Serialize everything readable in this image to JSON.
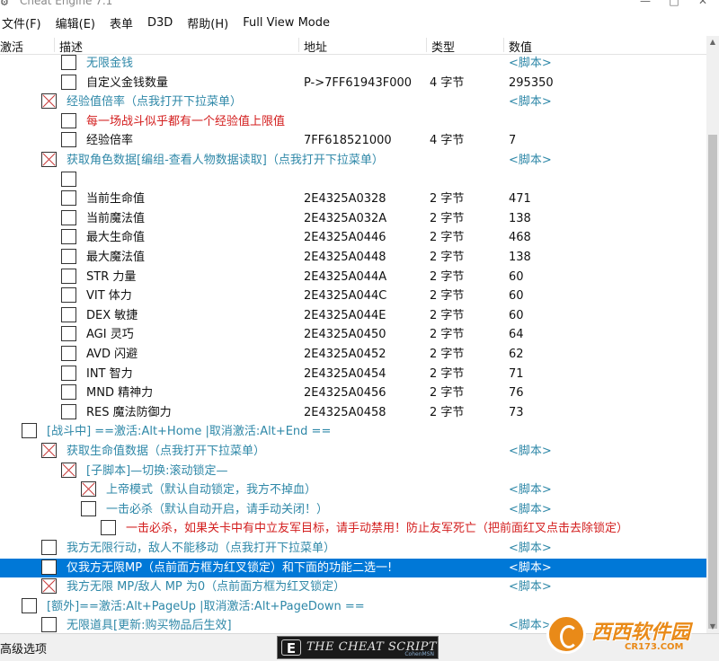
{
  "window": {
    "title": "Cheat Engine 7.1",
    "controls": [
      "—",
      "□",
      "✕"
    ]
  },
  "menu": [
    "文件(F)",
    "编辑(E)",
    "表单",
    "D3D",
    "帮助(H)",
    "Full View Mode"
  ],
  "columns": {
    "active": "激活",
    "description": "描述",
    "address": "地址",
    "type": "类型",
    "value": "数值"
  },
  "rows": [
    {
      "indent": 4,
      "checked": false,
      "desc": "无限金钱",
      "color": "blue",
      "addr": "",
      "type": "",
      "value": "<脚本>",
      "script": true
    },
    {
      "indent": 4,
      "checked": false,
      "desc": "自定义金钱数量",
      "color": "black",
      "addr": "P->7FF61943F000",
      "type": "4 字节",
      "value": "295350"
    },
    {
      "indent": 3,
      "checked": true,
      "desc": "经验值倍率（点我打开下拉菜单）",
      "color": "blue",
      "addr": "",
      "type": "",
      "value": "<脚本>",
      "script": true
    },
    {
      "indent": 4,
      "checked": false,
      "desc": "每一场战斗似乎都有一个经验值上限值",
      "color": "red",
      "addr": "",
      "type": "",
      "value": ""
    },
    {
      "indent": 4,
      "checked": false,
      "desc": "经验倍率",
      "color": "black",
      "addr": "7FF618521000",
      "type": "4 字节",
      "value": "7"
    },
    {
      "indent": 3,
      "checked": true,
      "desc": "获取角色数据[编组-查看人物数据读取]（点我打开下拉菜单）",
      "color": "blue",
      "addr": "",
      "type": "",
      "value": "<脚本>",
      "script": true
    },
    {
      "indent": 4,
      "checked": false,
      "desc": "",
      "color": "black",
      "addr": "",
      "type": "",
      "value": ""
    },
    {
      "indent": 4,
      "checked": false,
      "desc": "当前生命值",
      "color": "black",
      "addr": "2E4325A0328",
      "type": "2 字节",
      "value": "471"
    },
    {
      "indent": 4,
      "checked": false,
      "desc": "当前魔法值",
      "color": "black",
      "addr": "2E4325A032A",
      "type": "2 字节",
      "value": "138"
    },
    {
      "indent": 4,
      "checked": false,
      "desc": "最大生命值",
      "color": "black",
      "addr": "2E4325A0446",
      "type": "2 字节",
      "value": "468"
    },
    {
      "indent": 4,
      "checked": false,
      "desc": "最大魔法值",
      "color": "black",
      "addr": "2E4325A0448",
      "type": "2 字节",
      "value": "138"
    },
    {
      "indent": 4,
      "checked": false,
      "desc": "STR 力量",
      "color": "black",
      "addr": "2E4325A044A",
      "type": "2 字节",
      "value": "60"
    },
    {
      "indent": 4,
      "checked": false,
      "desc": "VIT  体力",
      "color": "black",
      "addr": "2E4325A044C",
      "type": "2 字节",
      "value": "60"
    },
    {
      "indent": 4,
      "checked": false,
      "desc": "DEX 敏捷",
      "color": "black",
      "addr": "2E4325A044E",
      "type": "2 字节",
      "value": "60"
    },
    {
      "indent": 4,
      "checked": false,
      "desc": "AGI 灵巧",
      "color": "black",
      "addr": "2E4325A0450",
      "type": "2 字节",
      "value": "64"
    },
    {
      "indent": 4,
      "checked": false,
      "desc": "AVD 闪避",
      "color": "black",
      "addr": "2E4325A0452",
      "type": "2 字节",
      "value": "62"
    },
    {
      "indent": 4,
      "checked": false,
      "desc": "INT 智力",
      "color": "black",
      "addr": "2E4325A0454",
      "type": "2 字节",
      "value": "71"
    },
    {
      "indent": 4,
      "checked": false,
      "desc": "MND 精神力",
      "color": "black",
      "addr": "2E4325A0456",
      "type": "2 字节",
      "value": "76"
    },
    {
      "indent": 4,
      "checked": false,
      "desc": "RES 魔法防御力",
      "color": "black",
      "addr": "2E4325A0458",
      "type": "2 字节",
      "value": "73"
    },
    {
      "indent": 1,
      "checked": false,
      "desc": "[战斗中] ==激活:Alt+Home |取消激活:Alt+End ==",
      "color": "blue",
      "addr": "",
      "type": "",
      "value": ""
    },
    {
      "indent": 3,
      "checked": true,
      "desc": "获取生命值数据（点我打开下拉菜单）",
      "color": "blue",
      "addr": "",
      "type": "",
      "value": "<脚本>",
      "script": true
    },
    {
      "indent": 4,
      "checked": true,
      "desc": "[子脚本]—切换:滚动锁定—",
      "color": "blue",
      "addr": "",
      "type": "",
      "value": ""
    },
    {
      "indent": 5,
      "checked": true,
      "desc": "上帝模式（默认自动锁定，我方不掉血）",
      "color": "blue",
      "addr": "",
      "type": "",
      "value": "<脚本>",
      "script": true
    },
    {
      "indent": 5,
      "checked": false,
      "desc": "一击必杀（默认自动开启，请手动关闭！）",
      "color": "blue",
      "addr": "",
      "type": "",
      "value": "<脚本>",
      "script": true
    },
    {
      "indent": 6,
      "checked": false,
      "desc": "一击必杀，如果关卡中有中立友军目标，请手动禁用！防止友军死亡（把前面红叉点击去除锁定）",
      "color": "red",
      "addr": "",
      "type": "",
      "value": ""
    },
    {
      "indent": 3,
      "checked": false,
      "desc": "我方无限行动，敌人不能移动（点我打开下拉菜单）",
      "color": "blue",
      "addr": "",
      "type": "",
      "value": "<脚本>",
      "script": true
    },
    {
      "indent": 3,
      "checked": false,
      "desc": "仅我方无限MP（点前面方框为红叉锁定）和下面的功能二选一!",
      "color": "blue",
      "addr": "",
      "type": "",
      "value": "<脚本>",
      "script": true,
      "selected": true
    },
    {
      "indent": 3,
      "checked": true,
      "desc": "我方无限 MP/敌人 MP 为0（点前面方框为红叉锁定）",
      "color": "blue",
      "addr": "",
      "type": "",
      "value": "<脚本>",
      "script": true
    },
    {
      "indent": 1,
      "checked": false,
      "desc": "[额外]==激活:Alt+PageUp |取消激活:Alt+PageDown ==",
      "color": "blue",
      "addr": "",
      "type": "",
      "value": ""
    },
    {
      "indent": 3,
      "checked": false,
      "desc": "无限道具[更新:购买物品后生效]",
      "color": "blue",
      "addr": "",
      "type": "",
      "value": "<脚本>",
      "script": true
    }
  ],
  "status": {
    "advanced": "高级选项",
    "banner_text": "THE CHEAT SCRIPT",
    "banner_icon": "E",
    "banner_sub": "CohenMSN"
  },
  "watermark": {
    "text": "西西软件园",
    "url": "CR173.COM"
  },
  "colors": {
    "blue_text": "#2f88a8",
    "red_text": "#d31e1e",
    "selection": "#0078d7",
    "cross": "#c83a3a"
  }
}
